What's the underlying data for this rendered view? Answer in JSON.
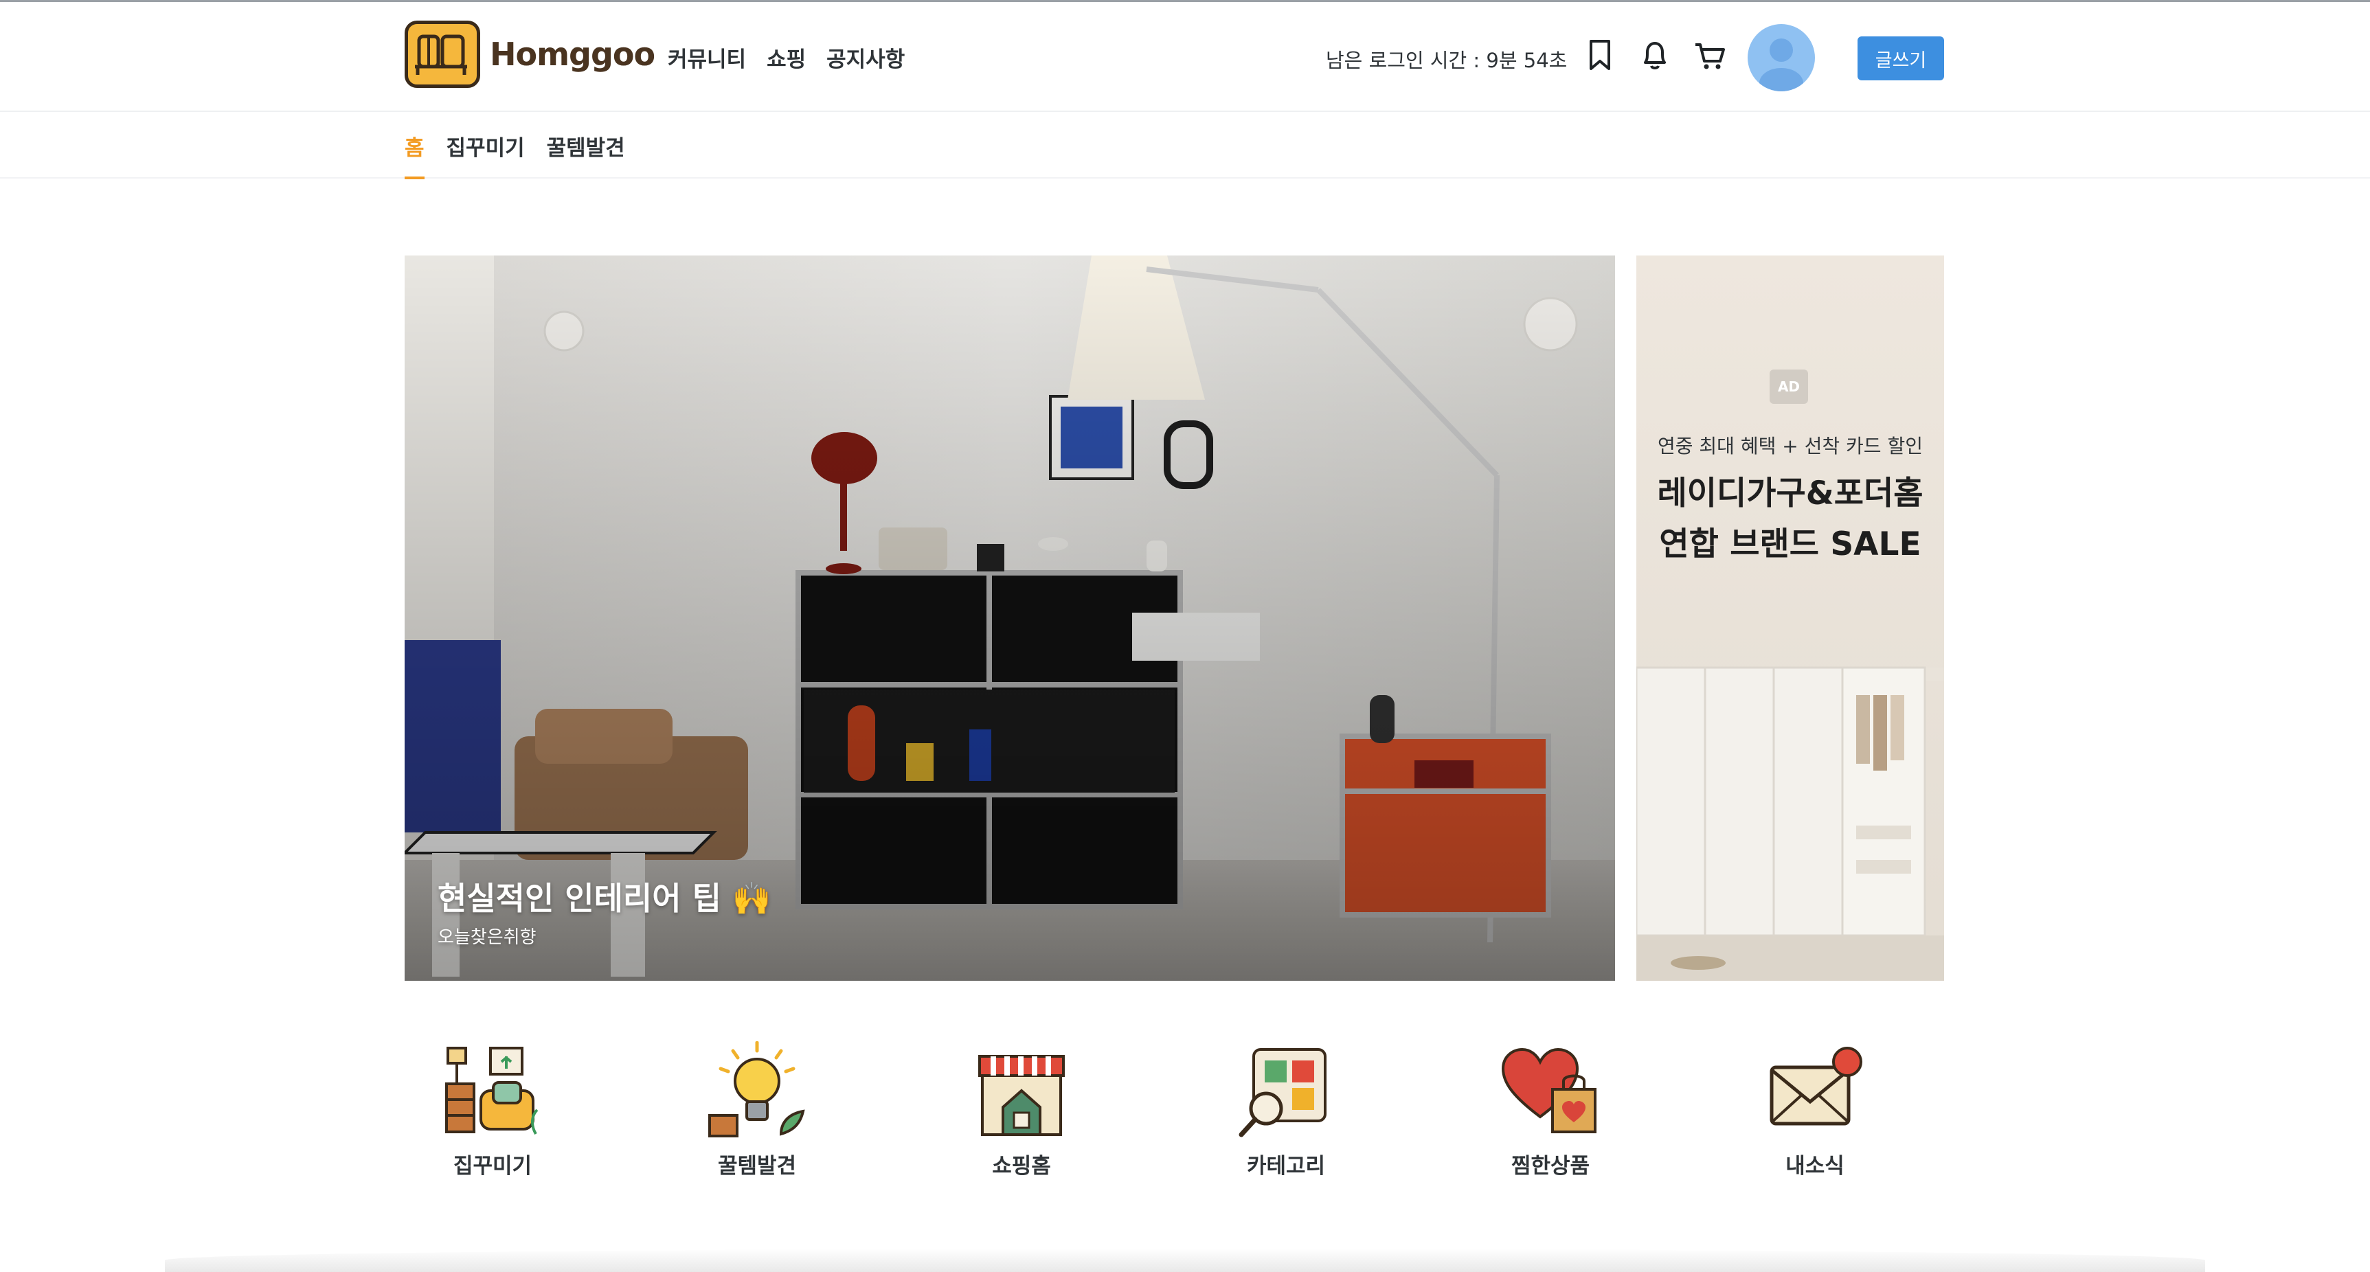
{
  "brand": {
    "name": "Homggoo"
  },
  "main_nav": [
    "커뮤니티",
    "쇼핑",
    "공지사항"
  ],
  "header": {
    "session_text": "남은 로그인 시간 : 9분 54초",
    "write_label": "글쓰기",
    "icons": [
      "bookmark-icon",
      "bell-icon",
      "cart-icon",
      "avatar"
    ]
  },
  "sub_nav": {
    "items": [
      "홈",
      "집꾸미기",
      "꿀템발견"
    ],
    "active": "홈"
  },
  "hero": {
    "title": "현실적인 인테리어 팁 🙌",
    "subtitle": "오늘찾은취향"
  },
  "ad": {
    "badge": "AD",
    "subtitle": "연중 최대 혜택 + 선착 카드 할인",
    "title_line1": "레이디가구&포더홈",
    "title_line2": "연합 브랜드 SALE"
  },
  "categories": [
    {
      "label": "집꾸미기",
      "icon": "furniture-icon"
    },
    {
      "label": "꿀템발견",
      "icon": "lightbulb-icon"
    },
    {
      "label": "쇼핑홈",
      "icon": "store-icon"
    },
    {
      "label": "카테고리",
      "icon": "category-icon"
    },
    {
      "label": "찜한상품",
      "icon": "heart-bag-icon"
    },
    {
      "label": "내소식",
      "icon": "mail-icon"
    }
  ],
  "colors": {
    "accent": "#f39b22",
    "button": "#3d8fe0",
    "logo": "#f5b73c"
  }
}
